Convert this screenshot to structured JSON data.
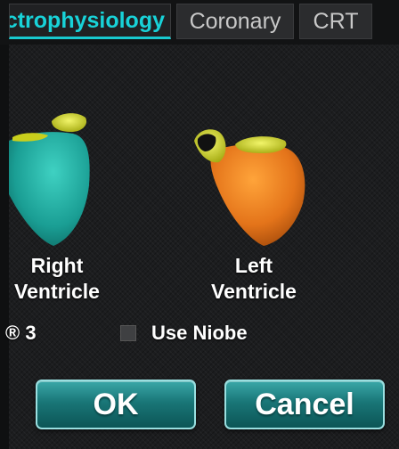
{
  "tabs": [
    {
      "label": "ctrophysiology",
      "active": true
    },
    {
      "label": "Coronary",
      "active": false
    },
    {
      "label": "CRT",
      "active": false
    }
  ],
  "ventricles": {
    "right": {
      "line1": "Right",
      "line2": "Ventricle",
      "color": "#1faaa0"
    },
    "left": {
      "line1": "Left",
      "line2": "Ventricle",
      "color": "#e4741a"
    }
  },
  "options": {
    "partial_label": "® 3",
    "use_niobe_label": "Use Niobe",
    "use_niobe_checked": false
  },
  "buttons": {
    "ok_label": "OK",
    "cancel_label": "Cancel"
  },
  "colors": {
    "accent": "#18d2d8",
    "button": "#197677",
    "valve": "#d8e01a"
  }
}
